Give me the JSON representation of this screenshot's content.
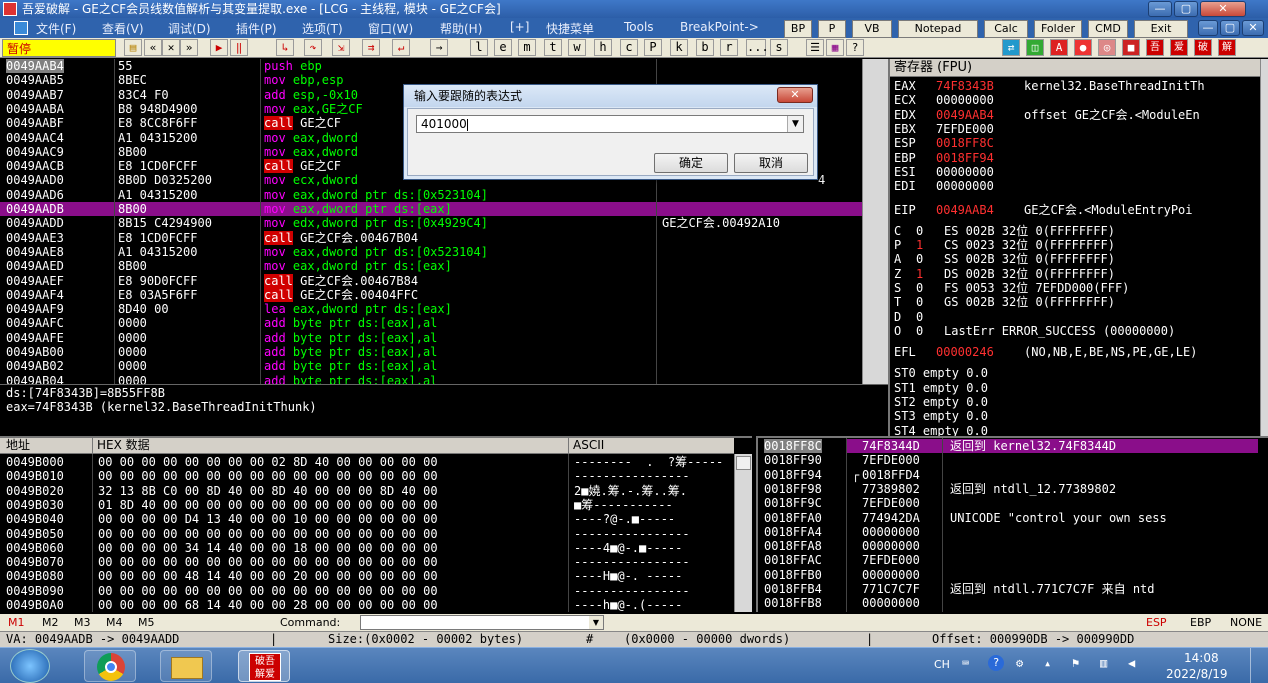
{
  "window": {
    "title": "吾爱破解 - GE之CF会员线数值解析与其变量提取.exe - [LCG - 主线程, 模块 - GE之CF会]",
    "min": "—",
    "max": "▢",
    "close": "✕",
    "inner_min": "—",
    "inner_restore": "▢",
    "inner_close": "✕"
  },
  "menu": {
    "items": [
      "文件(F)",
      "查看(V)",
      "调试(D)",
      "插件(P)",
      "选项(T)",
      "窗口(W)",
      "帮助(H)",
      "[+]",
      "快捷菜单",
      "Tools",
      "BreakPoint->"
    ],
    "quick": [
      "BP",
      "P",
      "VB",
      "Notepad",
      "Calc",
      "Folder",
      "CMD",
      "Exit"
    ]
  },
  "toolbar": {
    "status": "暂停",
    "letters": [
      "l",
      "e",
      "m",
      "t",
      "w",
      "h",
      "c",
      "P",
      "k",
      "b",
      "r",
      "...",
      "s"
    ]
  },
  "disasm": {
    "rows": [
      {
        "addr": "0049AAB4",
        "hex": "55",
        "asm": [
          [
            "push",
            "c-kw"
          ],
          [
            " ebp",
            "c-asm"
          ]
        ],
        "hl": "addr"
      },
      {
        "addr": "0049AAB5",
        "hex": "8BEC",
        "asm": [
          [
            "mov",
            "c-kw"
          ],
          [
            " ebp,esp",
            "c-asm"
          ]
        ]
      },
      {
        "addr": "0049AAB7",
        "hex": "83C4 F0",
        "asm": [
          [
            "add",
            "c-kw"
          ],
          [
            " esp,-0x10",
            "c-asm"
          ]
        ]
      },
      {
        "addr": "0049AABA",
        "hex": "B8 948D4900",
        "asm": [
          [
            "mov",
            "c-kw"
          ],
          [
            " eax,GE之CF",
            "c-asm"
          ]
        ]
      },
      {
        "addr": "0049AABF",
        "hex": "E8 8CC8F6FF",
        "asm": [
          [
            "call",
            "c-call"
          ],
          [
            " GE之CF",
            "c-white"
          ]
        ]
      },
      {
        "addr": "0049AAC4",
        "hex": "A1 04315200",
        "asm": [
          [
            "mov",
            "c-kw"
          ],
          [
            " eax,dword",
            "c-asm"
          ]
        ]
      },
      {
        "addr": "0049AAC9",
        "hex": "8B00",
        "asm": [
          [
            "mov",
            "c-kw"
          ],
          [
            " eax,dword",
            "c-asm"
          ]
        ]
      },
      {
        "addr": "0049AACB",
        "hex": "E8 1CD0FCFF",
        "asm": [
          [
            "call",
            "c-call"
          ],
          [
            " GE之CF",
            "c-white"
          ]
        ]
      },
      {
        "addr": "0049AAD0",
        "hex": "8B0D D0325200",
        "asm": [
          [
            "mov",
            "c-kw"
          ],
          [
            " ecx,dword",
            "c-asm"
          ]
        ]
      },
      {
        "addr": "0049AAD6",
        "hex": "A1 04315200",
        "asm": [
          [
            "mov",
            "c-kw"
          ],
          [
            " eax,dword ptr ds:[0x523104]",
            "c-asm"
          ]
        ]
      },
      {
        "addr": "0049AADB",
        "hex": "8B00",
        "asm": [
          [
            "mov",
            "c-kw"
          ],
          [
            " eax,dword ptr ds:[eax]",
            "c-asm"
          ]
        ],
        "hl": "row"
      },
      {
        "addr": "0049AADD",
        "hex": "8B15 C4294900",
        "asm": [
          [
            "mov",
            "c-kw"
          ],
          [
            " edx,dword ptr ds:[0x4929C4]",
            "c-asm"
          ]
        ],
        "comment": "GE之CF会.00492A10"
      },
      {
        "addr": "0049AAE3",
        "hex": "E8 1CD0FCFF",
        "asm": [
          [
            "call",
            "c-call"
          ],
          [
            " GE之CF会.00467B04",
            "c-white"
          ]
        ]
      },
      {
        "addr": "0049AAE8",
        "hex": "A1 04315200",
        "asm": [
          [
            "mov",
            "c-kw"
          ],
          [
            " eax,dword ptr ds:[0x523104]",
            "c-asm"
          ]
        ]
      },
      {
        "addr": "0049AAED",
        "hex": "8B00",
        "asm": [
          [
            "mov",
            "c-kw"
          ],
          [
            " eax,dword ptr ds:[eax]",
            "c-asm"
          ]
        ]
      },
      {
        "addr": "0049AAEF",
        "hex": "E8 90D0FCFF",
        "asm": [
          [
            "call",
            "c-call"
          ],
          [
            " GE之CF会.00467B84",
            "c-white"
          ]
        ]
      },
      {
        "addr": "0049AAF4",
        "hex": "E8 03A5F6FF",
        "asm": [
          [
            "call",
            "c-call"
          ],
          [
            " GE之CF会.00404FFC",
            "c-white"
          ]
        ]
      },
      {
        "addr": "0049AAF9",
        "hex": "8D40 00",
        "asm": [
          [
            "lea",
            "c-kw"
          ],
          [
            " eax,dword ptr ds:[eax]",
            "c-asm"
          ]
        ]
      },
      {
        "addr": "0049AAFC",
        "hex": "0000",
        "asm": [
          [
            "add",
            "c-kw"
          ],
          [
            " byte ptr ds:[eax],al",
            "c-asm"
          ]
        ]
      },
      {
        "addr": "0049AAFE",
        "hex": "0000",
        "asm": [
          [
            "add",
            "c-kw"
          ],
          [
            " byte ptr ds:[eax],al",
            "c-asm"
          ]
        ]
      },
      {
        "addr": "0049AB00",
        "hex": "0000",
        "asm": [
          [
            "add",
            "c-kw"
          ],
          [
            " byte ptr ds:[eax],al",
            "c-asm"
          ]
        ]
      },
      {
        "addr": "0049AB02",
        "hex": "0000",
        "asm": [
          [
            "add",
            "c-kw"
          ],
          [
            " byte ptr ds:[eax],al",
            "c-asm"
          ]
        ]
      },
      {
        "addr": "0049AB04",
        "hex": "0000",
        "asm": [
          [
            "add",
            "c-kw"
          ],
          [
            " byte ptr ds:[eax],al",
            "c-asm"
          ]
        ]
      }
    ],
    "partial_right": "4"
  },
  "info": {
    "line1": "ds:[74F8343B]=8B55FF8B",
    "line2": "eax=74F8343B (kernel32.BaseThreadInitThunk)"
  },
  "registers": {
    "header": "寄存器 (FPU)",
    "gp": [
      {
        "n": "EAX",
        "v": "74F8343B",
        "red": true,
        "c": "kernel32.BaseThreadInitTh"
      },
      {
        "n": "ECX",
        "v": "00000000",
        "red": false,
        "c": ""
      },
      {
        "n": "EDX",
        "v": "0049AAB4",
        "red": true,
        "c": "offset GE之CF会.<ModuleEn"
      },
      {
        "n": "EBX",
        "v": "7EFDE000",
        "red": false,
        "c": ""
      },
      {
        "n": "ESP",
        "v": "0018FF8C",
        "red": true,
        "c": ""
      },
      {
        "n": "EBP",
        "v": "0018FF94",
        "red": true,
        "c": ""
      },
      {
        "n": "ESI",
        "v": "00000000",
        "red": false,
        "c": ""
      },
      {
        "n": "EDI",
        "v": "00000000",
        "red": false,
        "c": ""
      }
    ],
    "eip": {
      "n": "EIP",
      "v": "0049AAB4",
      "c": "GE之CF会.<ModuleEntryPoi"
    },
    "flags": [
      {
        "f": "C",
        "v": "0",
        "red": false,
        "seg": "ES 002B 32位 0(FFFFFFFF)"
      },
      {
        "f": "P",
        "v": "1",
        "red": true,
        "seg": "CS 0023 32位 0(FFFFFFFF)"
      },
      {
        "f": "A",
        "v": "0",
        "red": false,
        "seg": "SS 002B 32位 0(FFFFFFFF)"
      },
      {
        "f": "Z",
        "v": "1",
        "red": true,
        "seg": "DS 002B 32位 0(FFFFFFFF)"
      },
      {
        "f": "S",
        "v": "0",
        "red": false,
        "seg": "FS 0053 32位 7EFDD000(FFF)"
      },
      {
        "f": "T",
        "v": "0",
        "red": false,
        "seg": "GS 002B 32位 0(FFFFFFFF)"
      },
      {
        "f": "D",
        "v": "0",
        "red": false,
        "seg": ""
      },
      {
        "f": "O",
        "v": "0",
        "red": false,
        "seg": "LastErr ERROR_SUCCESS (00000000)"
      }
    ],
    "efl": {
      "n": "EFL",
      "v": "00000246",
      "c": "(NO,NB,E,BE,NS,PE,GE,LE)"
    },
    "st": [
      "ST0 empty 0.0",
      "ST1 empty 0.0",
      "ST2 empty 0.0",
      "ST3 empty 0.0",
      "ST4 empty 0.0"
    ]
  },
  "dump": {
    "col_addr": "地址",
    "col_hex": "HEX 数据",
    "col_ascii": "ASCII",
    "rows": [
      {
        "addr": "0049B000",
        "hex": "00 00 00 00 00 00 00 00 02 8D 40 00 00 00 00 00",
        "ascii": "--------  .  ?筹-----"
      },
      {
        "addr": "0049B010",
        "hex": "00 00 00 00 00 00 00 00 00 00 00 00 00 00 00 00",
        "ascii": "----------------"
      },
      {
        "addr": "0049B020",
        "hex": "32 13 8B C0 00 8D 40 00 8D 40 00 00 00 8D 40 00",
        "ascii": "2■嬈.筹.-.筹..筹."
      },
      {
        "addr": "0049B030",
        "hex": "01 8D 40 00 00 00 00 00 00 00 00 00 00 00 00 00",
        "ascii": "■筹-----------"
      },
      {
        "addr": "0049B040",
        "hex": "00 00 00 00 D4 13 40 00 00 10 00 00 00 00 00 00",
        "ascii": "----?@-.■-----"
      },
      {
        "addr": "0049B050",
        "hex": "00 00 00 00 00 00 00 00 00 00 00 00 00 00 00 00",
        "ascii": "----------------"
      },
      {
        "addr": "0049B060",
        "hex": "00 00 00 00 34 14 40 00 00 18 00 00 00 00 00 00",
        "ascii": "----4■@-.■-----"
      },
      {
        "addr": "0049B070",
        "hex": "00 00 00 00 00 00 00 00 00 00 00 00 00 00 00 00",
        "ascii": "----------------"
      },
      {
        "addr": "0049B080",
        "hex": "00 00 00 00 48 14 40 00 00 20 00 00 00 00 00 00",
        "ascii": "----H■@-. -----"
      },
      {
        "addr": "0049B090",
        "hex": "00 00 00 00 00 00 00 00 00 00 00 00 00 00 00 00",
        "ascii": "----------------"
      },
      {
        "addr": "0049B0A0",
        "hex": "00 00 00 00 68 14 40 00 00 28 00 00 00 00 00 00",
        "ascii": "----h■@-.(-----"
      }
    ]
  },
  "stack": {
    "rows": [
      {
        "addr": "0018FF8C",
        "val": "74F8344D",
        "c": "返回到 kernel32.74F8344D",
        "sel": true
      },
      {
        "addr": "0018FF90",
        "val": "7EFDE000",
        "c": ""
      },
      {
        "addr": "0018FF94",
        "val": "0018FFD4",
        "c": "",
        "bracket": true
      },
      {
        "addr": "0018FF98",
        "val": "77389802",
        "c": "返回到 ntdll_12.77389802"
      },
      {
        "addr": "0018FF9C",
        "val": "7EFDE000",
        "c": ""
      },
      {
        "addr": "0018FFA0",
        "val": "774942DA",
        "c": "UNICODE \"control your own sess"
      },
      {
        "addr": "0018FFA4",
        "val": "00000000",
        "c": ""
      },
      {
        "addr": "0018FFA8",
        "val": "00000000",
        "c": ""
      },
      {
        "addr": "0018FFAC",
        "val": "7EFDE000",
        "c": ""
      },
      {
        "addr": "0018FFB0",
        "val": "00000000",
        "c": ""
      },
      {
        "addr": "0018FFB4",
        "val": "771C7C7F",
        "c": "返回到 ntdll.771C7C7F 来自 ntd"
      },
      {
        "addr": "0018FFB8",
        "val": "00000000",
        "c": ""
      }
    ]
  },
  "dialog": {
    "title": "输入要跟随的表达式",
    "close": "✕",
    "value": "401000",
    "ok": "确定",
    "cancel": "取消"
  },
  "cmdbar": {
    "m": [
      "M1",
      "M2",
      "M3",
      "M4",
      "M5"
    ],
    "label": "Command:",
    "right": [
      "ESP",
      "EBP",
      "NONE"
    ]
  },
  "statusbar": {
    "va": "VA: 0049AADB -> 0049AADD",
    "size": "Size:(0x0002 - 00002 bytes)",
    "hash": "#",
    "dwords": "(0x0000 - 00000 dwords)",
    "offset": "Offset: 000990DB -> 000990DD"
  },
  "taskbar": {
    "lang": "CH",
    "time": "14:08",
    "date": "2022/8/19",
    "app_label": "破吾解爱"
  },
  "colors": {
    "selection": "#8a0e8a",
    "call_bg": "#d00000",
    "keyword": "#ff00ff",
    "operand": "#00ff00"
  }
}
